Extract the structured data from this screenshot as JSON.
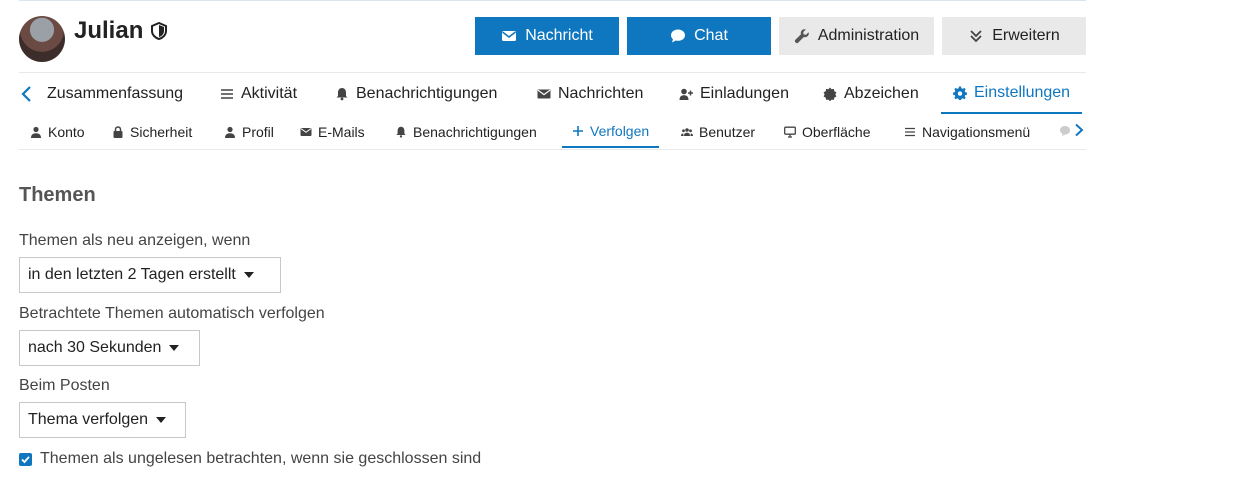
{
  "header": {
    "username": "Julian",
    "buttons": {
      "message": "Nachricht",
      "chat": "Chat",
      "admin": "Administration",
      "expand": "Erweitern"
    }
  },
  "nav_primary": {
    "items": [
      "Zusammenfassung",
      "Aktivität",
      "Benachrichtigungen",
      "Nachrichten",
      "Einladungen",
      "Abzeichen",
      "Einstellungen"
    ],
    "active": "Einstellungen"
  },
  "nav_secondary": {
    "items": [
      "Konto",
      "Sicherheit",
      "Profil",
      "E-Mails",
      "Benachrichtigungen",
      "Verfolgen",
      "Benutzer",
      "Oberfläche",
      "Navigationsmenü"
    ],
    "active": "Verfolgen"
  },
  "content": {
    "title": "Themen",
    "fields": [
      {
        "label": "Themen als neu anzeigen, wenn",
        "value": "in den letzten 2 Tagen erstellt"
      },
      {
        "label": "Betrachtete Themen automatisch verfolgen",
        "value": "nach 30 Sekunden"
      },
      {
        "label": "Beim Posten",
        "value": "Thema verfolgen"
      }
    ],
    "checkbox": {
      "label": "Themen als ungelesen betrachten, wenn sie geschlossen sind",
      "checked": true
    }
  },
  "colors": {
    "accent": "#0f77c0",
    "secondary_button": "#e9e9e9"
  }
}
